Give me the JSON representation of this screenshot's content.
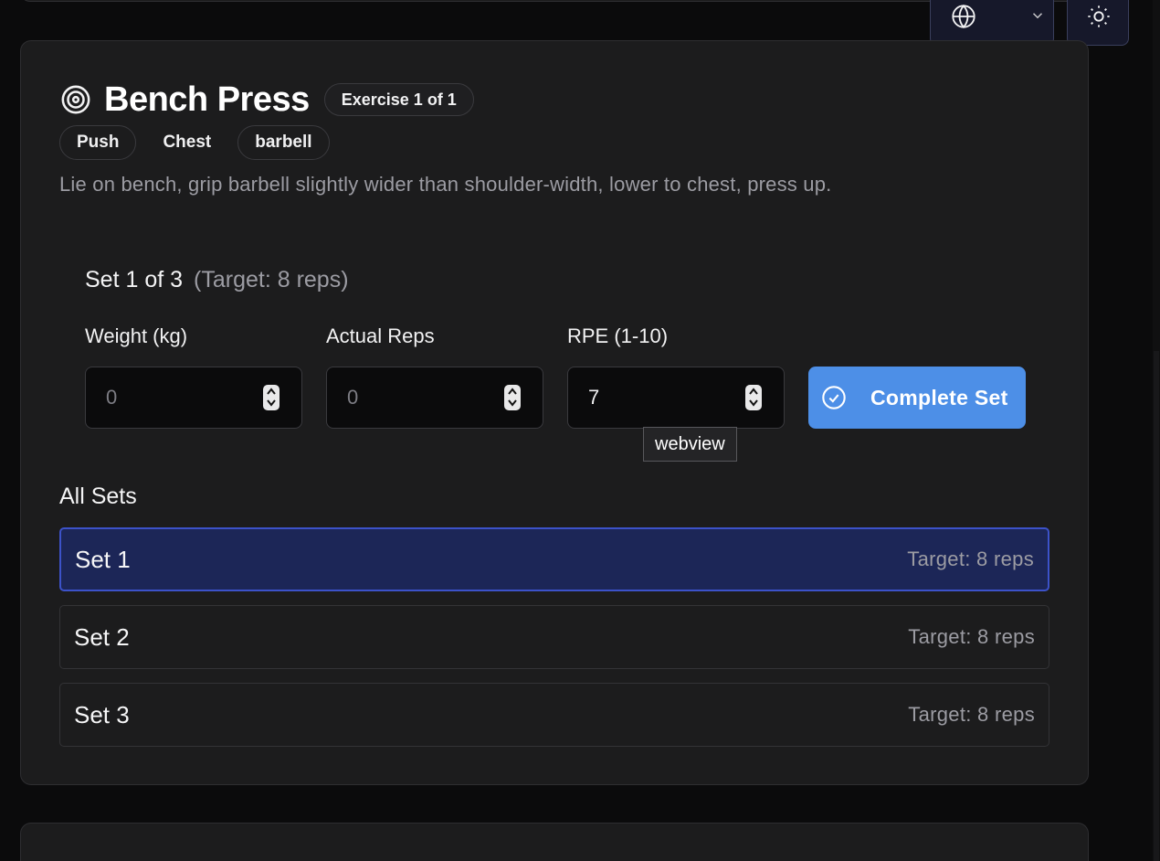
{
  "header": {
    "language_icon": "globe-icon",
    "language_chevron": "chevron-down-icon",
    "theme_icon": "sun-icon"
  },
  "exercise": {
    "icon": "target-icon",
    "title": "Bench Press",
    "badge": "Exercise 1 of 1",
    "tags": [
      "Push",
      "Chest",
      "barbell"
    ],
    "description": "Lie on bench, grip barbell slightly wider than shoulder-width, lower to chest, press up."
  },
  "current_set": {
    "label": "Set 1 of 3",
    "target": "(Target: 8 reps)",
    "fields": [
      {
        "label": "Weight (kg)",
        "value": "0",
        "placeholder": true
      },
      {
        "label": "Actual Reps",
        "value": "0",
        "placeholder": true
      },
      {
        "label": "RPE (1-10)",
        "value": "7",
        "placeholder": false
      }
    ],
    "complete_button": "Complete Set",
    "complete_icon": "check-circle-icon"
  },
  "tooltip": "webview",
  "all_sets": {
    "heading": "All Sets",
    "rows": [
      {
        "name": "Set 1",
        "target": "Target: 8 reps",
        "active": true
      },
      {
        "name": "Set 2",
        "target": "Target: 8 reps",
        "active": false
      },
      {
        "name": "Set 3",
        "target": "Target: 8 reps",
        "active": false
      }
    ]
  },
  "colors": {
    "background": "#0b0b0c",
    "card": "#1c1c1d",
    "accent": "#4d8fe7",
    "active_row": "#1c2657",
    "active_border": "#3c52c9"
  }
}
